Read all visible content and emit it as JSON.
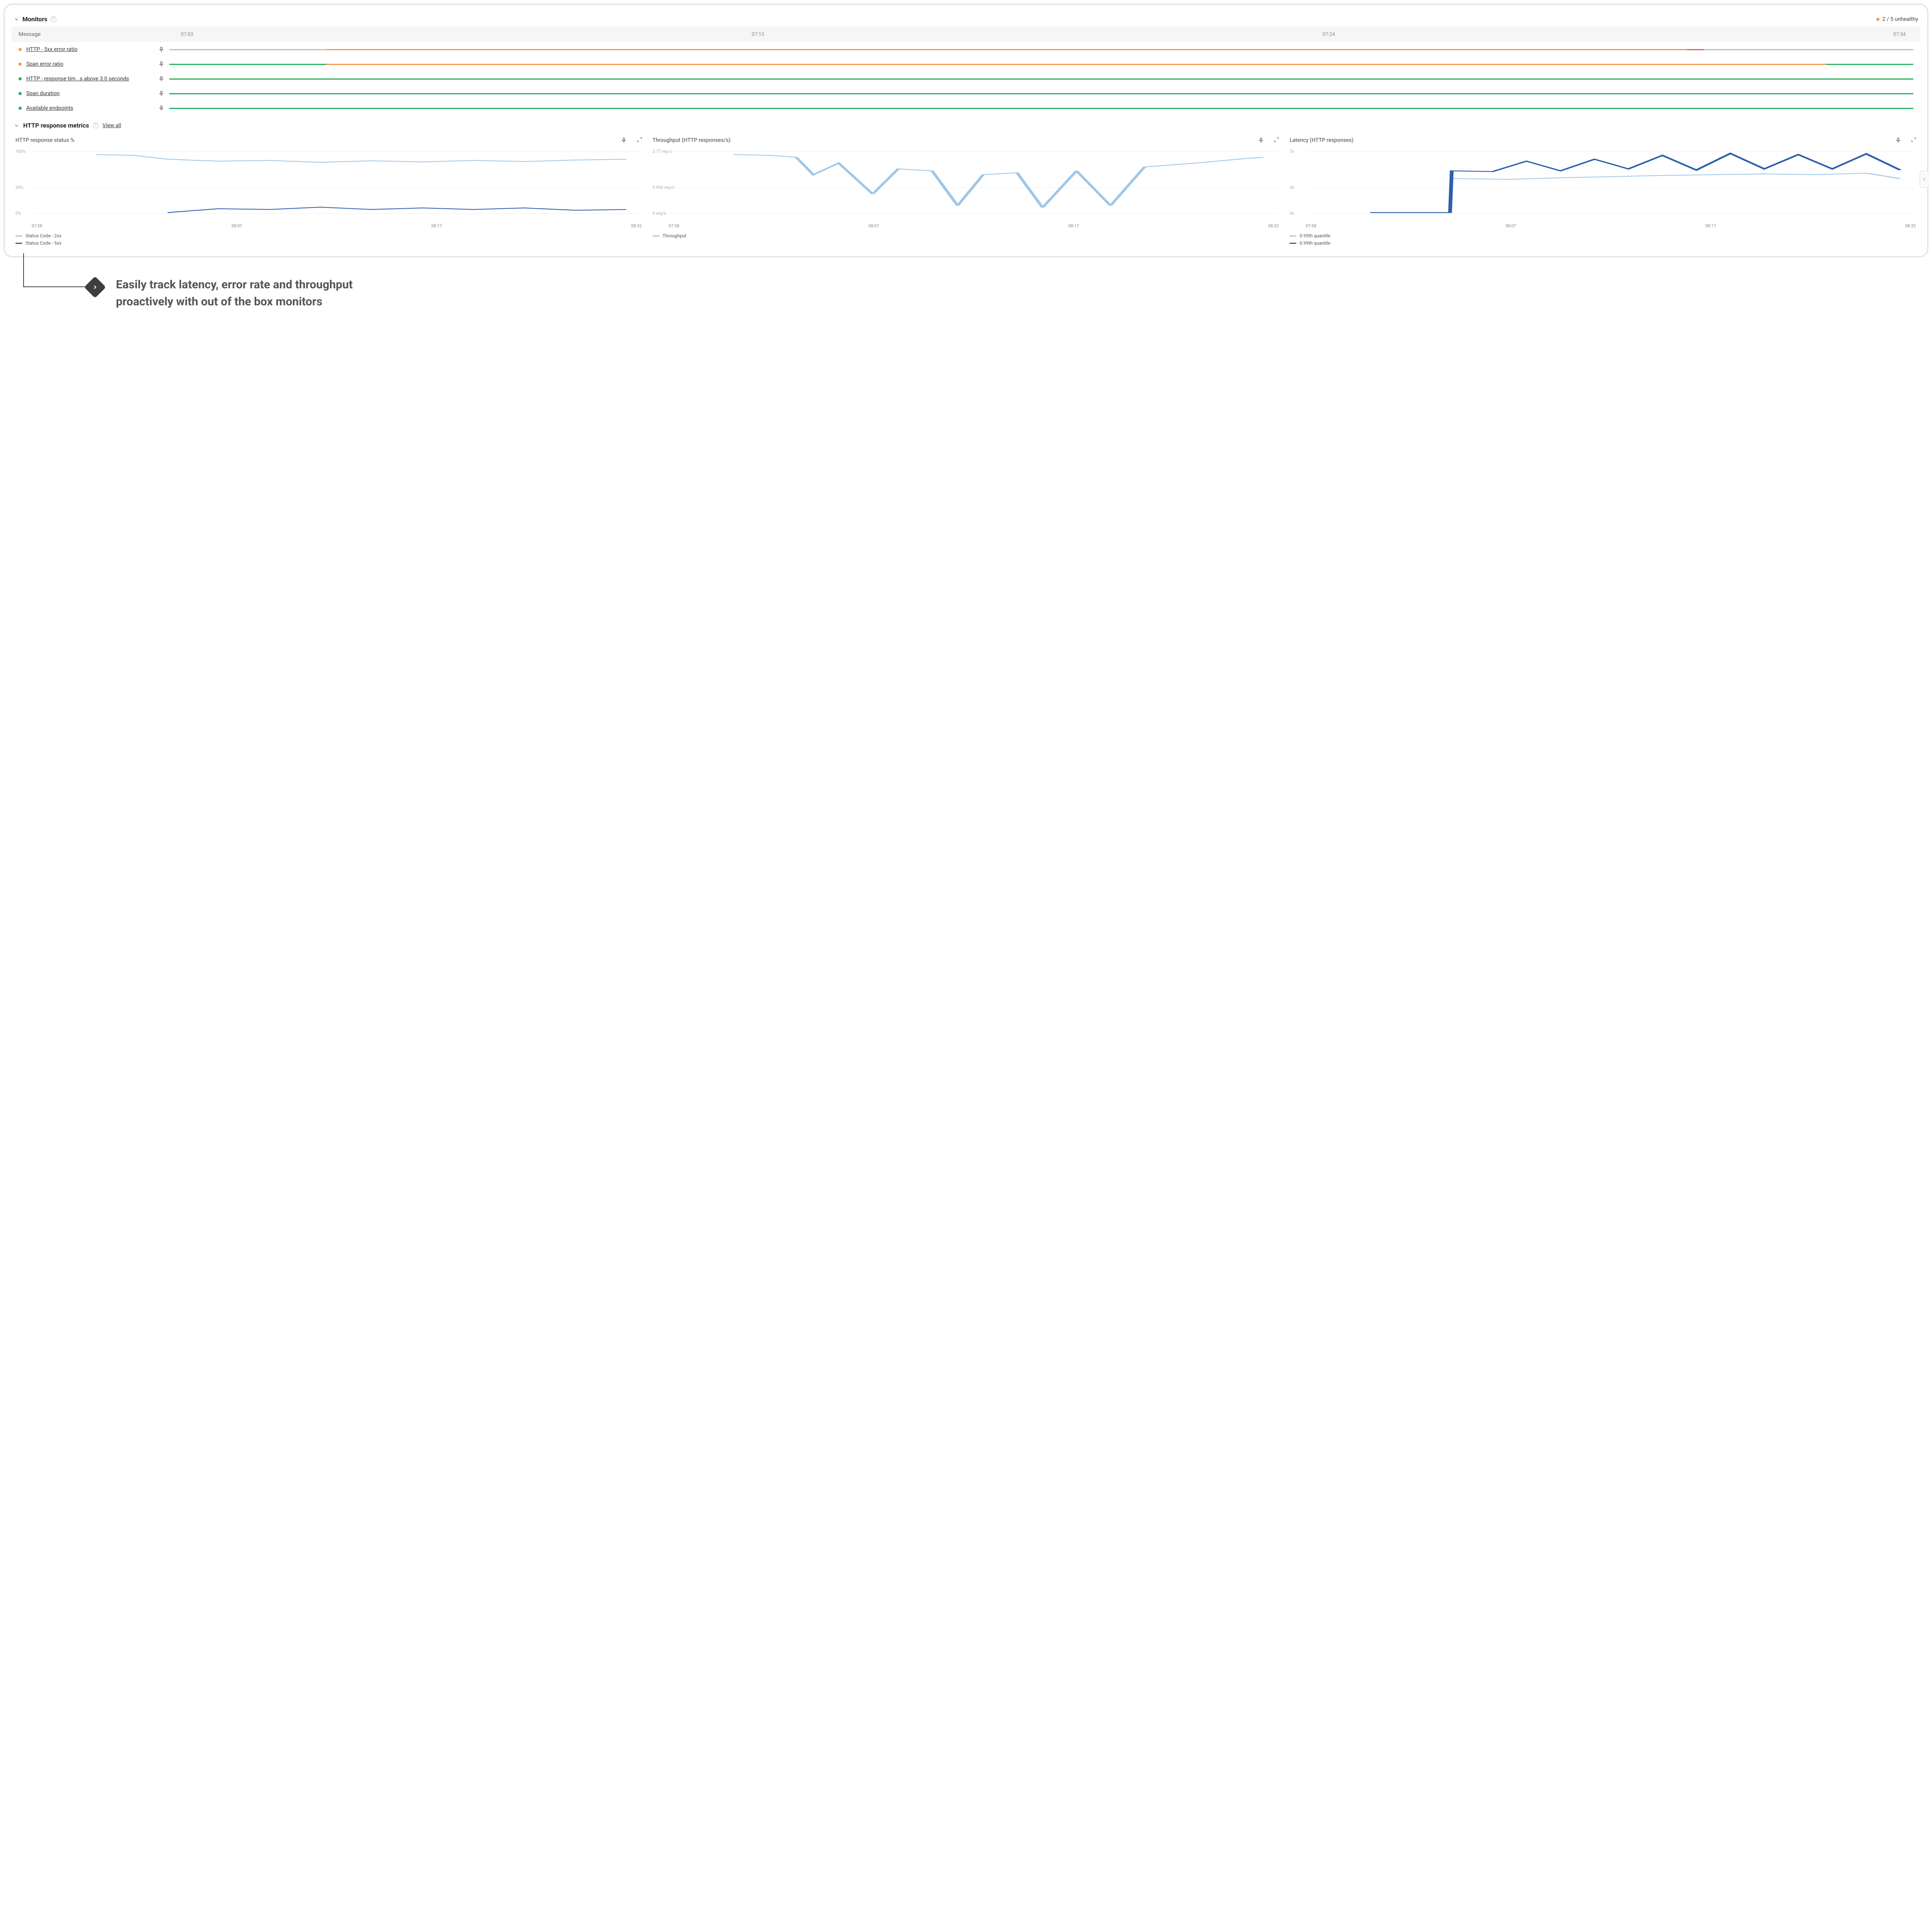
{
  "monitors": {
    "title": "Monitors",
    "status_text": "2 / 5 unhealthy",
    "header": {
      "message": "Message",
      "times": [
        "07:03",
        "07:13",
        "07:24",
        "07:34"
      ]
    },
    "rows": [
      {
        "status": "orange",
        "name": "HTTP - 5xx error ratio",
        "segments": [
          [
            "gray",
            9
          ],
          [
            "orange",
            78
          ],
          [
            "red",
            1
          ],
          [
            "gray",
            12
          ]
        ]
      },
      {
        "status": "orange",
        "name": "Span error ratio",
        "segments": [
          [
            "green",
            9
          ],
          [
            "orange",
            86
          ],
          [
            "green",
            5
          ]
        ]
      },
      {
        "status": "green",
        "name": "HTTP - response tim...s above 3.0 seconds",
        "segments": [
          [
            "green",
            100
          ]
        ]
      },
      {
        "status": "green",
        "name": "Span duration",
        "segments": [
          [
            "green",
            100
          ]
        ]
      },
      {
        "status": "green",
        "name": "Available endpoints",
        "segments": [
          [
            "green",
            100
          ]
        ]
      }
    ]
  },
  "metrics_section": {
    "title": "HTTP response metrics",
    "view_all": "View all"
  },
  "charts": [
    {
      "title": "HTTP response status %",
      "yticks": [
        "100%",
        "35%",
        "0%"
      ],
      "xticks": [
        "07:58",
        "08:07",
        "08:17",
        "08:32"
      ],
      "legend": [
        [
          "light",
          "Status Code - 2xx"
        ],
        [
          "dark",
          "Status Code - 5xx"
        ]
      ]
    },
    {
      "title": "Throughput (HTTP responses/s)",
      "yticks": [
        "2.77 req/s",
        "0.950 req/s",
        "0 req/s"
      ],
      "xticks": [
        "07:58",
        "08:07",
        "08:17",
        "08:32"
      ],
      "legend": [
        [
          "light",
          "Throughput"
        ]
      ]
    },
    {
      "title": "Latency (HTTP responses)",
      "yticks": [
        "7s",
        "3s",
        "0s"
      ],
      "xticks": [
        "07:58",
        "08:07",
        "08:17",
        "08:32"
      ],
      "legend": [
        [
          "light",
          "0.95th quantile"
        ],
        [
          "dark",
          "0.99th quantile"
        ]
      ]
    }
  ],
  "callout": "Easily track latency, error rate and throughput proactively with out of the box monitors",
  "chart_data": [
    {
      "type": "line",
      "title": "HTTP response status %",
      "xlabel": "",
      "ylabel": "%",
      "ylim": [
        0,
        100
      ],
      "x": [
        "07:58",
        "08:02",
        "08:07",
        "08:12",
        "08:17",
        "08:22",
        "08:27",
        "08:32"
      ],
      "series": [
        {
          "name": "Status Code - 2xx",
          "values": [
            95,
            92,
            85,
            83,
            84,
            82,
            86,
            88
          ]
        },
        {
          "name": "Status Code - 5xx",
          "values": [
            0,
            0,
            8,
            12,
            10,
            12,
            9,
            8
          ]
        }
      ]
    },
    {
      "type": "line",
      "title": "Throughput (HTTP responses/s)",
      "xlabel": "",
      "ylabel": "req/s",
      "ylim": [
        0,
        2.77
      ],
      "x": [
        "07:58",
        "08:02",
        "08:07",
        "08:12",
        "08:17",
        "08:22",
        "08:27",
        "08:32"
      ],
      "series": [
        {
          "name": "Throughput",
          "values": [
            2.6,
            2.5,
            1.6,
            0.5,
            1.8,
            0.4,
            1.9,
            2.4
          ]
        }
      ]
    },
    {
      "type": "line",
      "title": "Latency (HTTP responses)",
      "xlabel": "",
      "ylabel": "s",
      "ylim": [
        0,
        7
      ],
      "x": [
        "07:58",
        "08:02",
        "08:07",
        "08:12",
        "08:17",
        "08:22",
        "08:27",
        "08:32"
      ],
      "series": [
        {
          "name": "0.95th quantile",
          "values": [
            0.2,
            0.2,
            3.1,
            3.0,
            3.3,
            3.4,
            3.6,
            3.0
          ]
        },
        {
          "name": "0.99th quantile",
          "values": [
            0.3,
            0.3,
            4.2,
            4.1,
            5.8,
            4.6,
            6.6,
            4.4
          ]
        }
      ]
    }
  ]
}
